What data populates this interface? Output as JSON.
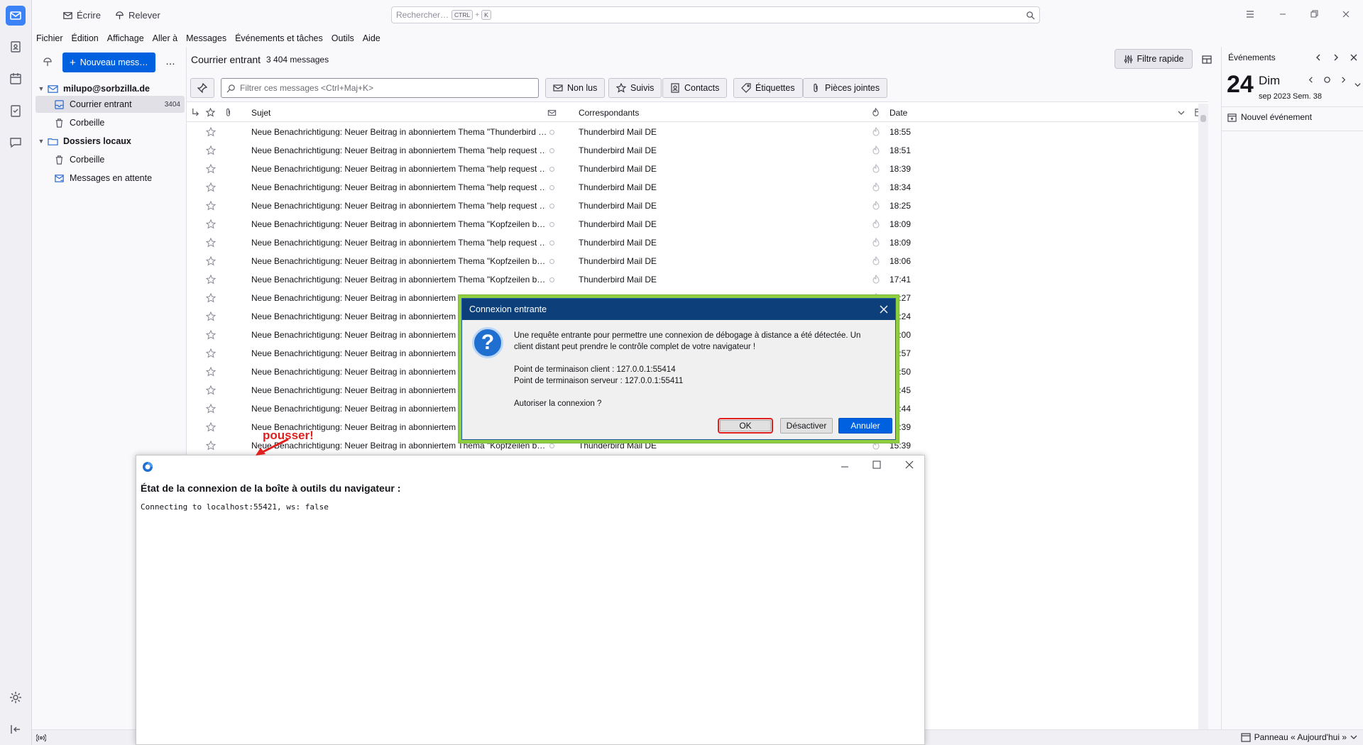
{
  "toolbar": {
    "write": "Écrire",
    "fetch": "Relever",
    "search_placeholder": "Rechercher…",
    "kbd_ctrl": "CTRL",
    "kbd_plus": "+",
    "kbd_k": "K"
  },
  "menu": [
    "Fichier",
    "Édition",
    "Affichage",
    "Aller à",
    "Messages",
    "Événements et tâches",
    "Outils",
    "Aide"
  ],
  "folders": {
    "new_message": "Nouveau mess…",
    "more": "…",
    "account": "milupo@sorbzilla.de",
    "inbox": "Courrier entrant",
    "inbox_count": "3404",
    "trash": "Corbeille",
    "local": "Dossiers locaux",
    "local_trash": "Corbeille",
    "outbox": "Messages en attente"
  },
  "thread": {
    "folder_title": "Courrier entrant",
    "message_count": "3 404 messages",
    "quick_filter": "Filtre rapide",
    "filter_placeholder": "Filtrer ces messages <Ctrl+Maj+K>",
    "filters": [
      "Non lus",
      "Suivis",
      "Contacts",
      "Étiquettes",
      "Pièces jointes"
    ],
    "col_subject": "Sujet",
    "col_correspondents": "Correspondants",
    "col_date": "Date",
    "rows": [
      {
        "subject": "Neue Benachrichtigung: Neuer Beitrag in abonniertem Thema \"Thunderbird …",
        "from": "Thunderbird Mail DE",
        "date": "18:55"
      },
      {
        "subject": "Neue Benachrichtigung: Neuer Beitrag in abonniertem Thema \"help request …",
        "from": "Thunderbird Mail DE",
        "date": "18:51"
      },
      {
        "subject": "Neue Benachrichtigung: Neuer Beitrag in abonniertem Thema \"help request …",
        "from": "Thunderbird Mail DE",
        "date": "18:39"
      },
      {
        "subject": "Neue Benachrichtigung: Neuer Beitrag in abonniertem Thema \"help request …",
        "from": "Thunderbird Mail DE",
        "date": "18:34"
      },
      {
        "subject": "Neue Benachrichtigung: Neuer Beitrag in abonniertem Thema \"help request …",
        "from": "Thunderbird Mail DE",
        "date": "18:25"
      },
      {
        "subject": "Neue Benachrichtigung: Neuer Beitrag in abonniertem Thema \"Kopfzeilen b…",
        "from": "Thunderbird Mail DE",
        "date": "18:09"
      },
      {
        "subject": "Neue Benachrichtigung: Neuer Beitrag in abonniertem Thema \"help request …",
        "from": "Thunderbird Mail DE",
        "date": "18:09"
      },
      {
        "subject": "Neue Benachrichtigung: Neuer Beitrag in abonniertem Thema \"Kopfzeilen b…",
        "from": "Thunderbird Mail DE",
        "date": "18:06"
      },
      {
        "subject": "Neue Benachrichtigung: Neuer Beitrag in abonniertem Thema \"Kopfzeilen b…",
        "from": "Thunderbird Mail DE",
        "date": "17:41"
      },
      {
        "subject": "Neue Benachrichtigung: Neuer Beitrag in abonniertem",
        "from": "",
        "date": "17:27"
      },
      {
        "subject": "Neue Benachrichtigung: Neuer Beitrag in abonniertem",
        "from": "",
        "date": "17:24"
      },
      {
        "subject": "Neue Benachrichtigung: Neuer Beitrag in abonniertem",
        "from": "",
        "date": "17:00"
      },
      {
        "subject": "Neue Benachrichtigung: Neuer Beitrag in abonniertem",
        "from": "",
        "date": "16:57"
      },
      {
        "subject": "Neue Benachrichtigung: Neuer Beitrag in abonniertem",
        "from": "",
        "date": "16:50"
      },
      {
        "subject": "Neue Benachrichtigung: Neuer Beitrag in abonniertem",
        "from": "",
        "date": "16:45"
      },
      {
        "subject": "Neue Benachrichtigung: Neuer Beitrag in abonniertem",
        "from": "",
        "date": "16:44"
      },
      {
        "subject": "Neue Benachrichtigung: Neuer Beitrag in abonniertem",
        "from": "",
        "date": "16:39"
      },
      {
        "subject": "Neue Benachrichtigung: Neuer Beitrag in abonniertem Thema \"Kopfzeilen b…",
        "from": "Thunderbird Mail DE",
        "date": "15:39"
      }
    ]
  },
  "today": {
    "title": "Événements",
    "day": "24",
    "weekday": "Dim",
    "month_year": "sep 2023",
    "week": "Sem. 38",
    "new_event": "Nouvel événement"
  },
  "status": {
    "today_pane": "Panneau « Aujourd'hui »"
  },
  "dialog": {
    "title": "Connexion entrante",
    "line1": "Une requête entrante pour permettre une connexion de débogage à distance a été détectée. Un",
    "line2": "client distant peut prendre le contrôle complet de votre navigateur !",
    "client": "Point de terminaison client : 127.0.0.1:55414",
    "server": "Point de terminaison serveur : 127.0.0.1:55411",
    "question": "Autoriser la connexion ?",
    "ok": "OK",
    "disable": "Désactiver",
    "cancel": "Annuler"
  },
  "toolbox": {
    "heading": "État de la connexion de la boîte à outils du navigateur :",
    "status": "Connecting to localhost:55421, ws: false"
  },
  "annotation": "pousser!",
  "colors": {
    "accent": "#0061e0",
    "dialog_title": "#0d3f7a",
    "highlight_green": "#8fce3f",
    "highlight_red": "#e0201e"
  }
}
